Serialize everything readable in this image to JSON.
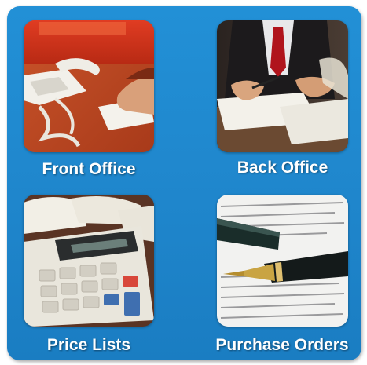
{
  "tiles": [
    {
      "label": "Front Office",
      "image": "front-office-photo"
    },
    {
      "label": "Back Office",
      "image": "back-office-photo"
    },
    {
      "label": "Price Lists",
      "image": "calculator-photo"
    },
    {
      "label": "Purchase Orders",
      "image": "pen-and-document-photo"
    }
  ],
  "colors": {
    "panel_background": "#1f86cc",
    "label_text": "#ffffff"
  }
}
